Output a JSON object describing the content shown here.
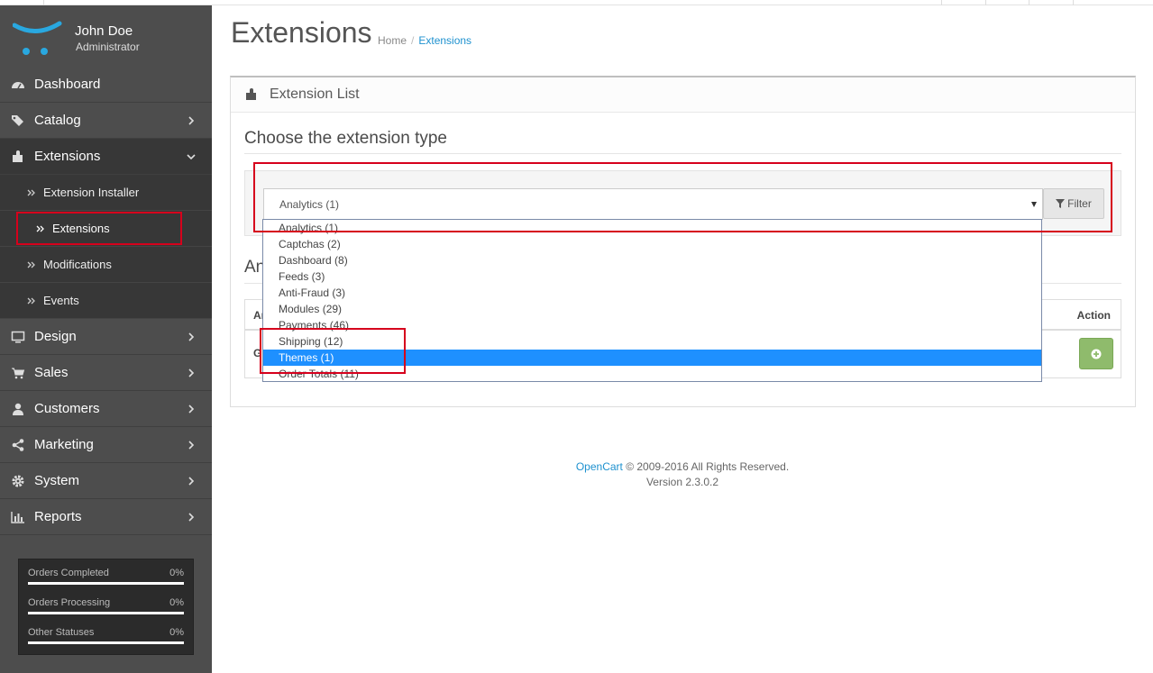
{
  "user": {
    "name": "John Doe",
    "role": "Administrator"
  },
  "sidebar": {
    "items": [
      {
        "label": "Dashboard",
        "icon": "dashboard-icon"
      },
      {
        "label": "Catalog",
        "icon": "tags-icon"
      },
      {
        "label": "Extensions",
        "icon": "puzzle-icon",
        "expanded": true
      },
      {
        "label": "Design",
        "icon": "monitor-icon"
      },
      {
        "label": "Sales",
        "icon": "cart-icon"
      },
      {
        "label": "Customers",
        "icon": "user-icon"
      },
      {
        "label": "Marketing",
        "icon": "share-icon"
      },
      {
        "label": "System",
        "icon": "gear-icon"
      },
      {
        "label": "Reports",
        "icon": "bar-chart-icon"
      }
    ],
    "extensions_sub": [
      {
        "label": "Extension Installer"
      },
      {
        "label": "Extensions",
        "current": true
      },
      {
        "label": "Modifications"
      },
      {
        "label": "Events"
      }
    ]
  },
  "stats": [
    {
      "label": "Orders Completed",
      "value": "0%"
    },
    {
      "label": "Orders Processing",
      "value": "0%"
    },
    {
      "label": "Other Statuses",
      "value": "0%"
    }
  ],
  "page": {
    "title": "Extensions",
    "breadcrumb": {
      "home": "Home",
      "current": "Extensions"
    }
  },
  "panel": {
    "title": "Extension List",
    "choose_label": "Choose the extension type",
    "select_value": "Analytics (1)",
    "filter_label": "Filter",
    "list_heading": "An",
    "table": {
      "first_col_header": "Ar",
      "action_header": "Action",
      "first_cell": "G"
    }
  },
  "dropdown": {
    "options": [
      "Analytics (1)",
      "Captchas (2)",
      "Dashboard (8)",
      "Feeds (3)",
      "Anti-Fraud (3)",
      "Modules (29)",
      "Payments (46)",
      "Shipping (12)",
      "Themes (1)",
      "Order Totals (11)"
    ],
    "selected_index": 8
  },
  "footer": {
    "brand": "OpenCart",
    "copyright": " © 2009-2016 All Rights Reserved.",
    "version": "Version 2.3.0.2"
  },
  "colors": {
    "sidebar_bg": "#4d4d4d",
    "sidebar_active": "#373737",
    "highlight_red": "#d6001c",
    "selected_option": "#1e90ff",
    "add_button": "#8fbb6c",
    "link": "#1e91cf"
  }
}
